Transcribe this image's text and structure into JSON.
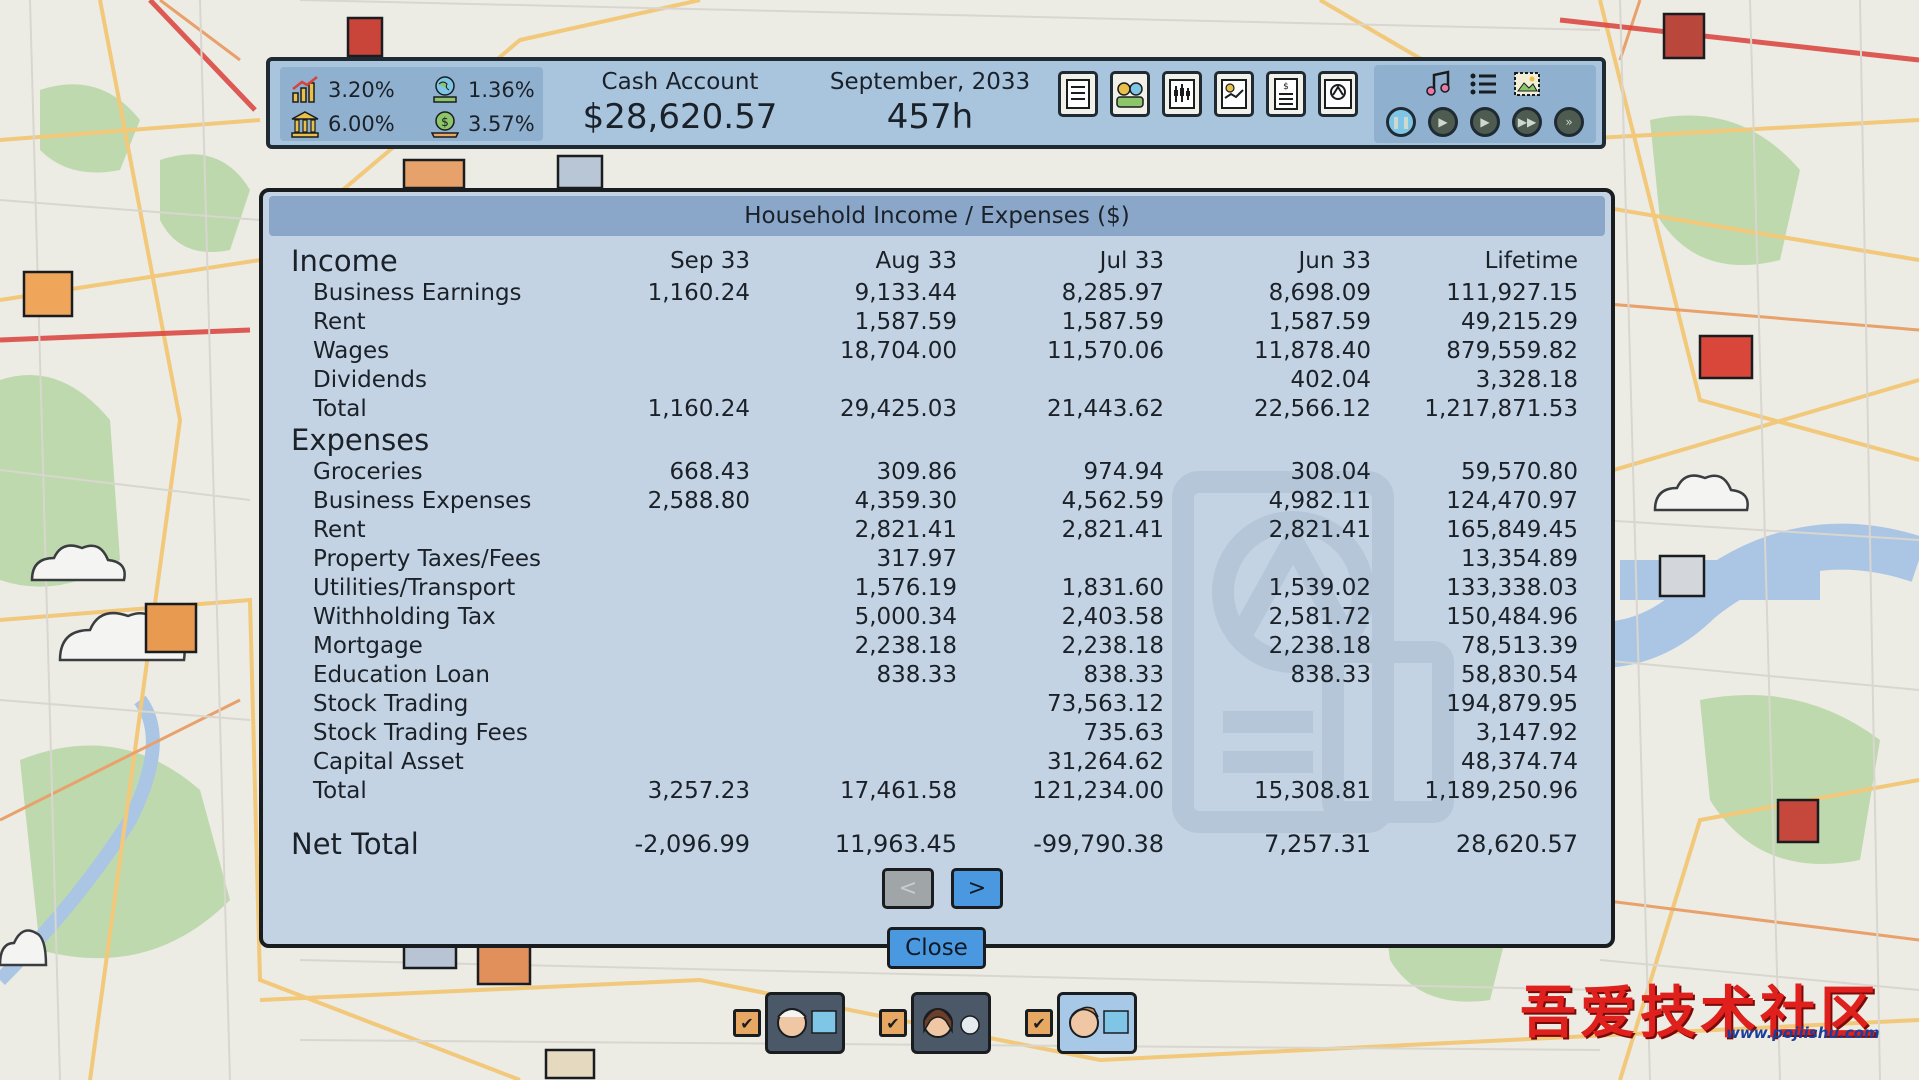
{
  "topbar": {
    "rate_1": "3.20%",
    "rate_2": "1.36%",
    "rate_3": "6.00%",
    "rate_4": "3.57%",
    "cash_label": "Cash Account",
    "cash_value": "$28,620.57",
    "date_label": "September, 2033",
    "hours": "457h",
    "tool_icons": [
      "checklist-icon",
      "people-icon",
      "stock-chart-icon",
      "report-icon",
      "receipt-icon",
      "bank-icon"
    ],
    "panel_icons": [
      "music-icon",
      "list-icon",
      "picture-icon"
    ],
    "speed_icons": [
      "pause-icon",
      "play-slow-icon",
      "play-icon",
      "fast-forward-icon",
      "fastest-icon"
    ]
  },
  "dialog": {
    "title": "Household Income / Expenses ($)",
    "columns": [
      "Sep 33",
      "Aug 33",
      "Jul 33",
      "Jun 33",
      "Lifetime"
    ],
    "income_label": "Income",
    "income_rows": [
      {
        "label": "Business Earnings",
        "values": [
          "1,160.24",
          "9,133.44",
          "8,285.97",
          "8,698.09",
          "111,927.15"
        ]
      },
      {
        "label": "Rent",
        "values": [
          "",
          "1,587.59",
          "1,587.59",
          "1,587.59",
          "49,215.29"
        ]
      },
      {
        "label": "Wages",
        "values": [
          "",
          "18,704.00",
          "11,570.06",
          "11,878.40",
          "879,559.82"
        ]
      },
      {
        "label": "Dividends",
        "values": [
          "",
          "",
          "",
          "402.04",
          "3,328.18"
        ]
      },
      {
        "label": "Total",
        "values": [
          "1,160.24",
          "29,425.03",
          "21,443.62",
          "22,566.12",
          "1,217,871.53"
        ]
      }
    ],
    "expenses_label": "Expenses",
    "expense_rows": [
      {
        "label": "Groceries",
        "values": [
          "668.43",
          "309.86",
          "974.94",
          "308.04",
          "59,570.80"
        ]
      },
      {
        "label": "Business Expenses",
        "values": [
          "2,588.80",
          "4,359.30",
          "4,562.59",
          "4,982.11",
          "124,470.97"
        ]
      },
      {
        "label": "Rent",
        "values": [
          "",
          "2,821.41",
          "2,821.41",
          "2,821.41",
          "165,849.45"
        ]
      },
      {
        "label": "Property Taxes/Fees",
        "values": [
          "",
          "317.97",
          "",
          "",
          "13,354.89"
        ]
      },
      {
        "label": "Utilities/Transport",
        "values": [
          "",
          "1,576.19",
          "1,831.60",
          "1,539.02",
          "133,338.03"
        ]
      },
      {
        "label": "Withholding Tax",
        "values": [
          "",
          "5,000.34",
          "2,403.58",
          "2,581.72",
          "150,484.96"
        ]
      },
      {
        "label": "Mortgage",
        "values": [
          "",
          "2,238.18",
          "2,238.18",
          "2,238.18",
          "78,513.39"
        ]
      },
      {
        "label": "Education Loan",
        "values": [
          "",
          "838.33",
          "838.33",
          "838.33",
          "58,830.54"
        ]
      },
      {
        "label": "Stock Trading",
        "values": [
          "",
          "",
          "73,563.12",
          "",
          "194,879.95"
        ]
      },
      {
        "label": "Stock Trading Fees",
        "values": [
          "",
          "",
          "735.63",
          "",
          "3,147.92"
        ]
      },
      {
        "label": "Capital Asset",
        "values": [
          "",
          "",
          "31,264.62",
          "",
          "48,374.74"
        ]
      },
      {
        "label": "Total",
        "values": [
          "3,257.23",
          "17,461.58",
          "121,234.00",
          "15,308.81",
          "1,189,250.96"
        ]
      }
    ],
    "net_label": "Net Total",
    "net_values": [
      "-2,096.99",
      "11,963.45",
      "-99,790.38",
      "7,257.31",
      "28,620.57"
    ],
    "prev_label": "<",
    "next_label": ">",
    "close_label": "Close"
  },
  "people": [
    {
      "checked": true,
      "selected": false
    },
    {
      "checked": true,
      "selected": false
    },
    {
      "checked": true,
      "selected": true
    }
  ],
  "brand": {
    "text": "吾爱技术社区",
    "url": "www.pojiishu.com"
  },
  "colors": {
    "panel": "#c4d3e3",
    "header": "#8aa6c8",
    "button": "#4a98e0",
    "topbar": "#a9c4dd"
  }
}
